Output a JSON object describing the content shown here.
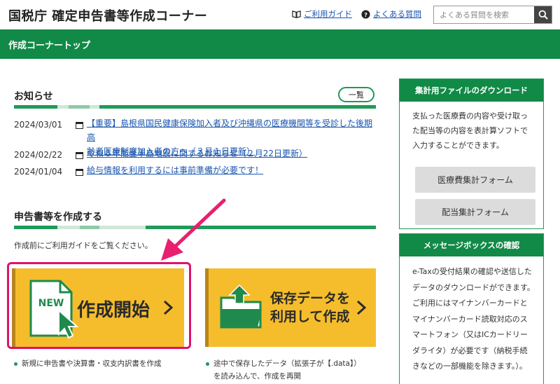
{
  "header": {
    "site_title": "国税庁 確定申告書等作成コーナー",
    "guide_link": "ご利用ガイド",
    "faq_link": "よくある質問",
    "search_placeholder": "よくある質問を検索"
  },
  "topbar": {
    "title": "作成コーナートップ"
  },
  "news": {
    "title": "お知らせ",
    "more_label": "一覧",
    "items": [
      {
        "date": "2024/03/01",
        "line1": "【重要】島根県国民健康保険加入者及び沖縄県の医療機関等を受診した後期高",
        "line2": "齢者医療制度加入者の方へ（３月１日更新）"
      },
      {
        "date": "2024/02/22",
        "line1": "令和６年能登半島地震に関するお知らせ（２月22日更新）"
      },
      {
        "date": "2024/01/04",
        "line1": "給与情報を利用するには事前準備が必要です！"
      }
    ]
  },
  "create": {
    "title": "申告書等を作成する",
    "guide_text": "作成前にご利用ガイドをご覧ください。",
    "new_card": {
      "badge": "NEW",
      "label": "作成開始"
    },
    "saved_card": {
      "line1": "保存データを",
      "line2": "利用して作成"
    },
    "new_note": "新規に申告書や決算書・収支内訳書を作成",
    "saved_note_line1": "途中で保存したデータ（拡張子が【.data】）",
    "saved_note_line2": "を読み込んで、作成を再開"
  },
  "sidebar": {
    "download": {
      "title": "集計用ファイルのダウンロード",
      "text": "支払った医療費の内容や受け取った配当等の内容を表計算ソフトで入力することができます。",
      "btn_medical": "医療費集計フォーム",
      "btn_dividend": "配当集計フォーム"
    },
    "messagebox": {
      "title": "メッセージボックスの確認",
      "text": "e-Taxの受付結果の確認や送信したデータのダウンロードができます。ご利用にはマイナンバーカードとマイナンバーカード読取対応のスマートフォン（又はICカードリーダライタ）が必要です（納税手続きなどの一部機能を除きます。）。"
    }
  },
  "colors": {
    "brand_green": "#118a47",
    "card_yellow": "#f5bd2c",
    "highlight_pink": "#e0136a",
    "link_blue": "#1a56b0"
  }
}
